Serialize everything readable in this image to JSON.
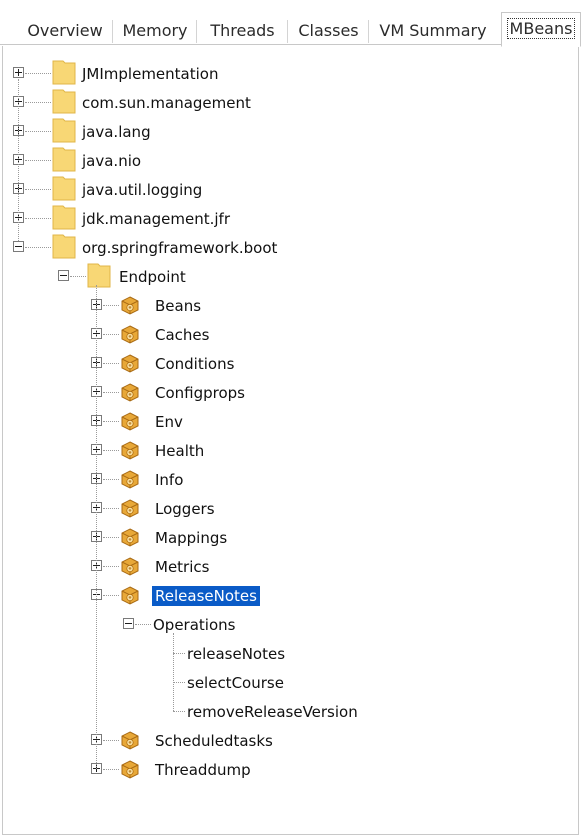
{
  "tabs": [
    {
      "label": "Overview",
      "active": false
    },
    {
      "label": "Memory",
      "active": false
    },
    {
      "label": "Threads",
      "active": false
    },
    {
      "label": "Classes",
      "active": false
    },
    {
      "label": "VM Summary",
      "active": false
    },
    {
      "label": "MBeans",
      "active": true
    }
  ],
  "tree": {
    "domains": [
      {
        "label": "JMImplementation",
        "state": "collapsed",
        "icon": "folder-icon"
      },
      {
        "label": "com.sun.management",
        "state": "collapsed",
        "icon": "folder-icon"
      },
      {
        "label": "java.lang",
        "state": "collapsed",
        "icon": "folder-icon"
      },
      {
        "label": "java.nio",
        "state": "collapsed",
        "icon": "folder-icon"
      },
      {
        "label": "java.util.logging",
        "state": "collapsed",
        "icon": "folder-icon"
      },
      {
        "label": "jdk.management.jfr",
        "state": "collapsed",
        "icon": "folder-icon"
      },
      {
        "label": "org.springframework.boot",
        "state": "expanded",
        "icon": "folder-icon"
      }
    ],
    "endpoint": {
      "label": "Endpoint",
      "state": "expanded",
      "icon": "folder-icon"
    },
    "beans": [
      {
        "label": "Beans",
        "state": "collapsed",
        "icon": "mbean-icon"
      },
      {
        "label": "Caches",
        "state": "collapsed",
        "icon": "mbean-icon"
      },
      {
        "label": "Conditions",
        "state": "collapsed",
        "icon": "mbean-icon"
      },
      {
        "label": "Configprops",
        "state": "collapsed",
        "icon": "mbean-icon"
      },
      {
        "label": "Env",
        "state": "collapsed",
        "icon": "mbean-icon"
      },
      {
        "label": "Health",
        "state": "collapsed",
        "icon": "mbean-icon"
      },
      {
        "label": "Info",
        "state": "collapsed",
        "icon": "mbean-icon"
      },
      {
        "label": "Loggers",
        "state": "collapsed",
        "icon": "mbean-icon"
      },
      {
        "label": "Mappings",
        "state": "collapsed",
        "icon": "mbean-icon"
      },
      {
        "label": "Metrics",
        "state": "collapsed",
        "icon": "mbean-icon"
      },
      {
        "label": "ReleaseNotes",
        "state": "expanded",
        "icon": "mbean-icon",
        "selected": true
      },
      {
        "label": "Scheduledtasks",
        "state": "collapsed",
        "icon": "mbean-icon"
      },
      {
        "label": "Threaddump",
        "state": "collapsed",
        "icon": "mbean-icon"
      }
    ],
    "operations": {
      "label": "Operations",
      "state": "expanded",
      "items": [
        "releaseNotes",
        "selectCourse",
        "removeReleaseVersion"
      ]
    }
  },
  "colors": {
    "selection": "#0a5bc7",
    "folder": "#f8d775",
    "bean": "#e8a838"
  }
}
